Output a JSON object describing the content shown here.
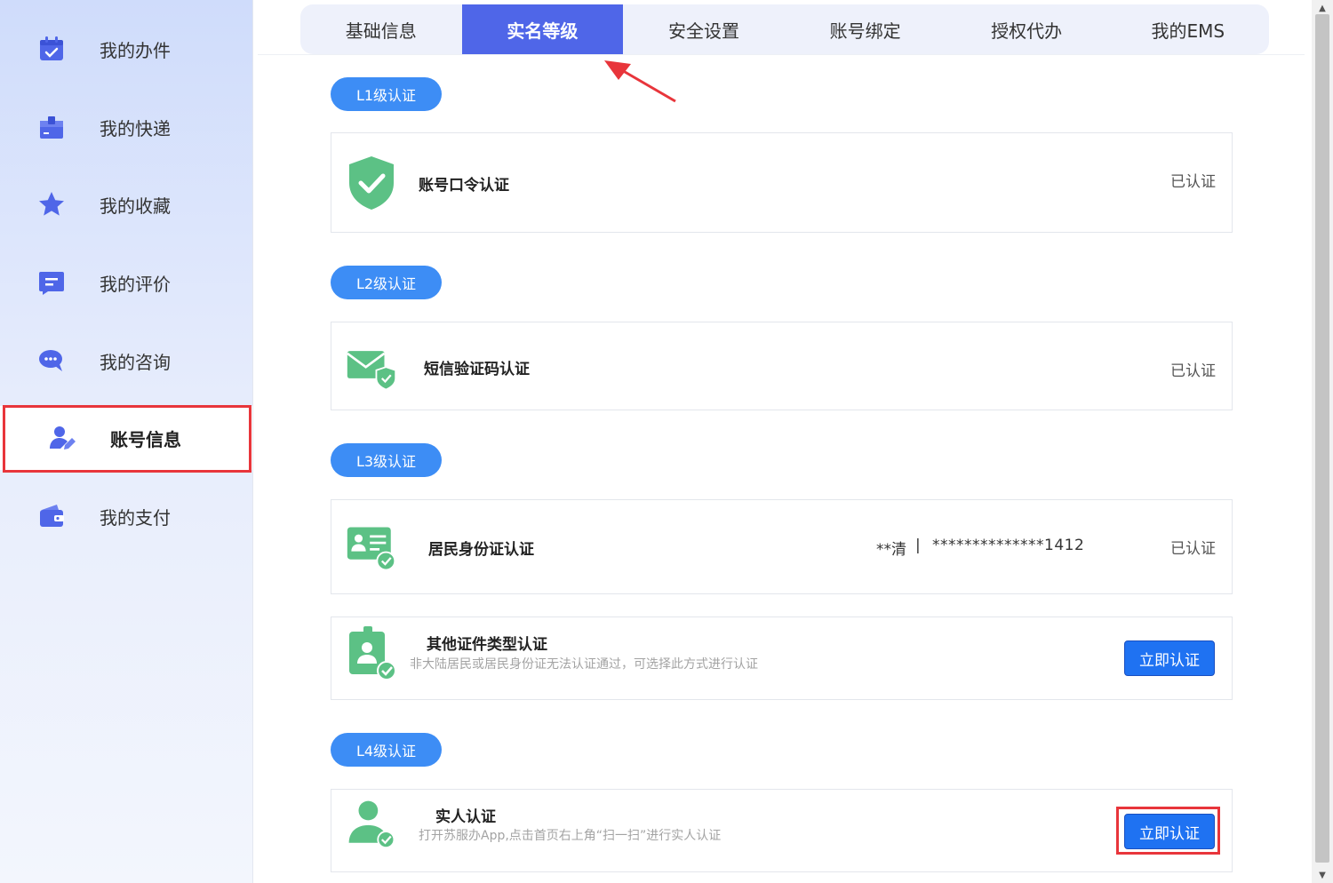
{
  "sidebar": {
    "items": [
      {
        "label": "我的办件",
        "icon": "calendar-check-icon"
      },
      {
        "label": "我的快递",
        "icon": "package-icon"
      },
      {
        "label": "我的收藏",
        "icon": "star-icon"
      },
      {
        "label": "我的评价",
        "icon": "comment-note-icon"
      },
      {
        "label": "我的咨询",
        "icon": "chat-bubble-icon"
      },
      {
        "label": "账号信息",
        "icon": "user-edit-icon",
        "active": true
      },
      {
        "label": "我的支付",
        "icon": "wallet-icon"
      }
    ]
  },
  "tabs": [
    {
      "label": "基础信息"
    },
    {
      "label": "实名等级",
      "active": true
    },
    {
      "label": "安全设置"
    },
    {
      "label": "账号绑定"
    },
    {
      "label": "授权代办"
    },
    {
      "label": "我的EMS"
    }
  ],
  "levels": {
    "l1": {
      "pill": "L1级认证",
      "cards": [
        {
          "title": "账号口令认证",
          "status": "已认证",
          "icon": "shield-check-icon"
        }
      ]
    },
    "l2": {
      "pill": "L2级认证",
      "cards": [
        {
          "title": "短信验证码认证",
          "status": "已认证",
          "icon": "envelope-shield-icon"
        }
      ]
    },
    "l3": {
      "pill": "L3级认证",
      "cards": [
        {
          "title": "居民身份证认证",
          "name": "**清",
          "sep": "|",
          "id_number": "**************1412",
          "status": "已认证",
          "icon": "id-card-check-icon"
        },
        {
          "title": "其他证件类型认证",
          "desc": "非大陆居民或居民身份证无法认证通过，可选择此方式进行认证",
          "button": "立即认证",
          "icon": "badge-person-icon"
        }
      ]
    },
    "l4": {
      "pill": "L4级认证",
      "cards": [
        {
          "title": "实人认证",
          "desc": "打开苏服办App,点击首页右上角“扫一扫”进行实人认证",
          "button": "立即认证",
          "icon": "person-check-icon"
        }
      ]
    }
  },
  "colors": {
    "accent": "#4f66e8",
    "pill": "#3d8df5",
    "button": "#1f72f2",
    "success": "#5cc185",
    "highlight": "#e8353b"
  }
}
